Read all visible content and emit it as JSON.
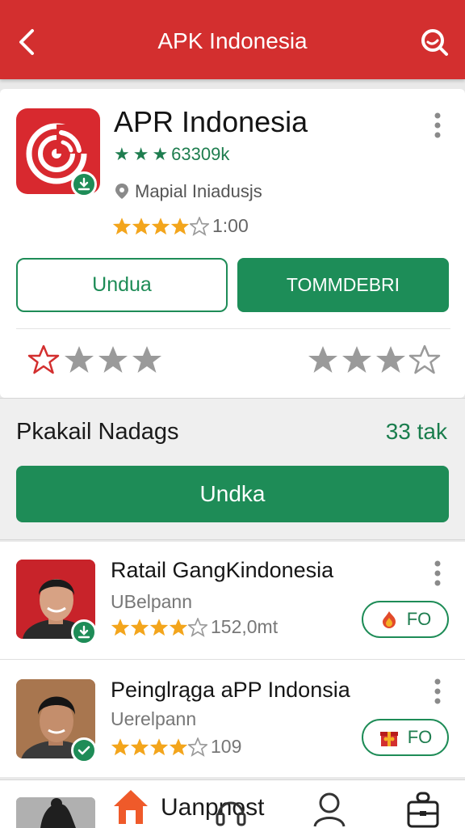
{
  "appbar": {
    "title": "APK Indonesia"
  },
  "app": {
    "name": "APR Indonesia",
    "green_rating_text": "63309k",
    "developer": "Mapial Iniadusjs",
    "rating_value": "1:00",
    "download_label": "Undua",
    "install_label": "TOMMDEBRI"
  },
  "section": {
    "title": "Pkakail Nadags",
    "count": "33 tak",
    "button_label": "Undka"
  },
  "list": [
    {
      "title": "Ratail GangKindonesia",
      "subtitle": "UBelpann",
      "rating": "152,0mt",
      "action": "FO"
    },
    {
      "title": "Peinglrąga aPP Indonsia",
      "subtitle": "Uerelpann",
      "rating": "109",
      "action": "FO"
    }
  ],
  "bottom_nav": {
    "label": "Uanpnost"
  },
  "colors": {
    "brand_red": "#d32f2f",
    "accent_green": "#1e8c57",
    "star_yellow": "#f3a51c"
  },
  "icons": [
    "back-arrow-icon",
    "search-icon",
    "kebab-icon",
    "download-badge-icon",
    "location-icon",
    "star-icon",
    "home-icon",
    "headphones-icon",
    "profile-icon",
    "bag-icon"
  ]
}
